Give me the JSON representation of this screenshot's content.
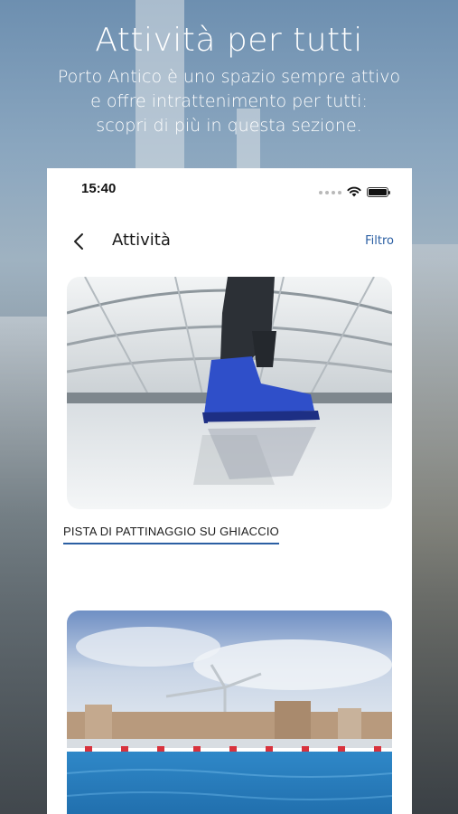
{
  "hero": {
    "title": "Attività per tutti",
    "subtitle_line1": "Porto Antico è uno spazio sempre attivo",
    "subtitle_line2": "e offre intrattenimento per tutti:",
    "subtitle_line3": "scopri di più in questa sezione."
  },
  "status_bar": {
    "time": "15:40"
  },
  "nav": {
    "title": "Attività",
    "filter_label": "Filtro"
  },
  "cards": [
    {
      "title": "PISTA DI PATTINAGGIO SU GHIACCIO"
    },
    {
      "title": ""
    }
  ],
  "colors": {
    "accent": "#2b5fa3",
    "text": "#1a1a1a",
    "background": "#ffffff"
  },
  "icons": {
    "back": "chevron-left-icon",
    "wifi": "wifi-icon",
    "battery": "battery-icon"
  }
}
